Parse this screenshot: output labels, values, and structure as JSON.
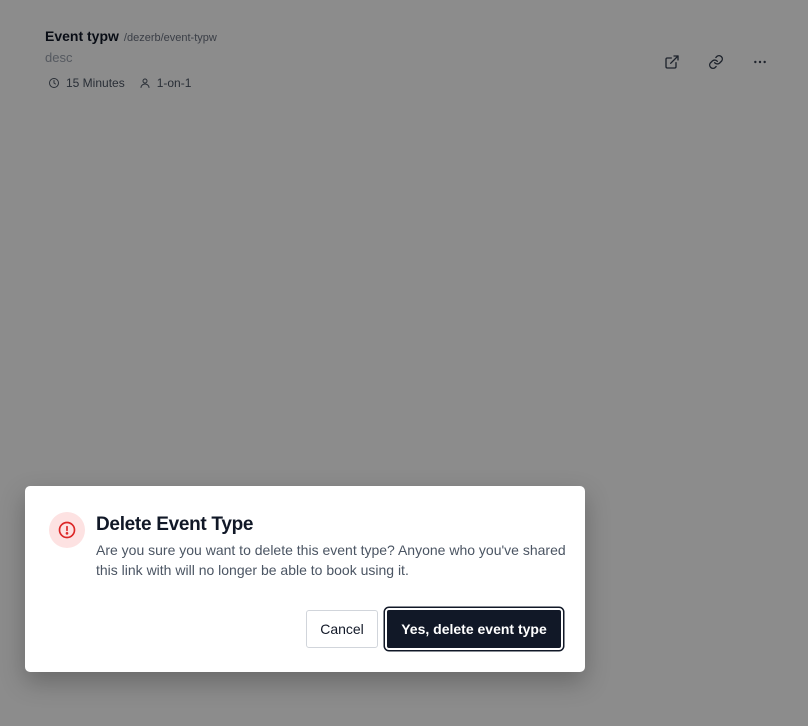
{
  "event_type": {
    "title": "Event typw",
    "slug": "/dezerb/event-typw",
    "description": "desc",
    "duration": "15 Minutes",
    "type": "1-on-1"
  },
  "dialog": {
    "title": "Delete Event Type",
    "message": "Are you sure you want to delete this event type? Anyone who you've shared this link with will no longer be able to book using it.",
    "cancel_label": "Cancel",
    "confirm_label": "Yes, delete event type"
  },
  "colors": {
    "danger": "#dc2626",
    "danger_bg": "#fde2e2",
    "primary": "#111827"
  }
}
